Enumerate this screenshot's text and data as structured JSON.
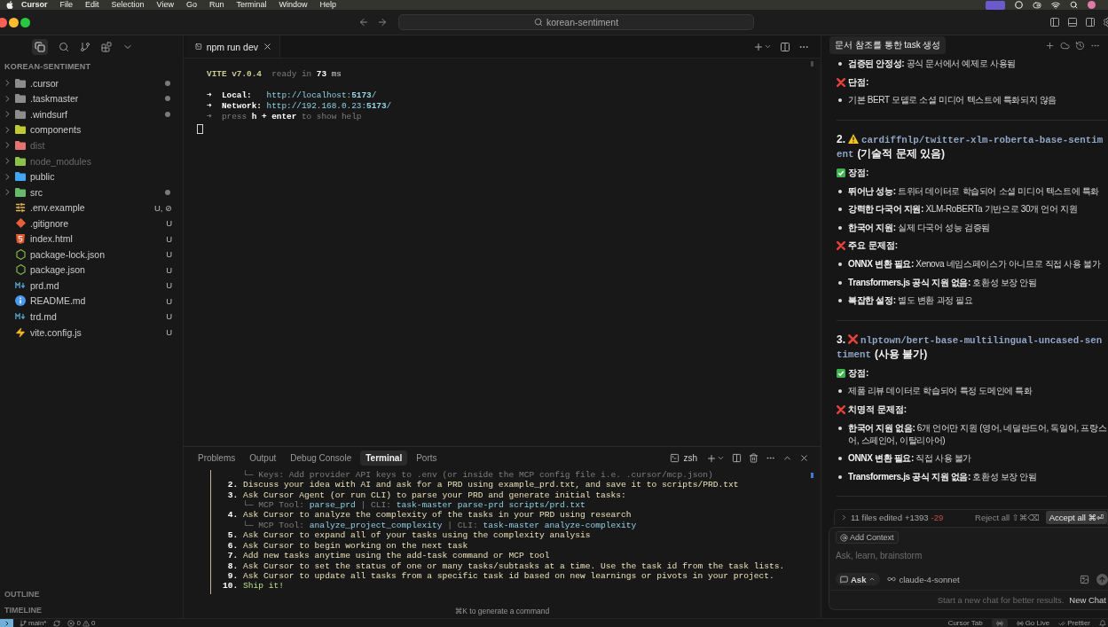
{
  "menu_bar": {
    "app": "Cursor",
    "items": [
      "File",
      "Edit",
      "Selection",
      "View",
      "Go",
      "Run",
      "Terminal",
      "Window",
      "Help"
    ]
  },
  "title_bar": {
    "search": "korean-sentiment"
  },
  "explorer": {
    "title": "KOREAN-SENTIMENT",
    "items": [
      {
        "kind": "folder",
        "label": ".cursor",
        "expanded": false,
        "color": "#8c8c8c",
        "dimmed": false,
        "modified": true
      },
      {
        "kind": "folder",
        "label": ".taskmaster",
        "expanded": false,
        "color": "#8c8c8c",
        "dimmed": false,
        "modified": true
      },
      {
        "kind": "folder",
        "label": ".windsurf",
        "expanded": false,
        "color": "#8c8c8c",
        "dimmed": false,
        "modified": true
      },
      {
        "kind": "folder",
        "label": "components",
        "expanded": false,
        "color": "#c0ca33",
        "dimmed": false,
        "modified": false
      },
      {
        "kind": "folder",
        "label": "dist",
        "expanded": false,
        "color": "#e57373",
        "dimmed": true,
        "modified": false
      },
      {
        "kind": "folder",
        "label": "node_modules",
        "expanded": false,
        "color": "#8bc34a",
        "dimmed": true,
        "modified": false
      },
      {
        "kind": "folder",
        "label": "public",
        "expanded": false,
        "color": "#42a5f5",
        "dimmed": false,
        "modified": false
      },
      {
        "kind": "folder",
        "label": "src",
        "expanded": false,
        "color": "#66bb6a",
        "dimmed": false,
        "modified": true
      },
      {
        "kind": "env",
        "label": ".env.example",
        "badge": "U, ⊘",
        "dimmed": false,
        "modified": false
      },
      {
        "kind": "git",
        "label": ".gitignore",
        "badge": "U",
        "dimmed": false,
        "modified": false
      },
      {
        "kind": "html",
        "label": "index.html",
        "badge": "U",
        "dimmed": false,
        "modified": false
      },
      {
        "kind": "nodejs",
        "label": "package-lock.json",
        "badge": "U",
        "dimmed": false,
        "modified": false
      },
      {
        "kind": "nodejs",
        "label": "package.json",
        "badge": "U",
        "dimmed": false,
        "modified": false
      },
      {
        "kind": "markdown",
        "label": "prd.md",
        "badge": "U",
        "dimmed": false,
        "modified": false
      },
      {
        "kind": "info",
        "label": "README.md",
        "badge": "U",
        "dimmed": false,
        "modified": false
      },
      {
        "kind": "markdown",
        "label": "trd.md",
        "badge": "U",
        "dimmed": false,
        "modified": false
      },
      {
        "kind": "vite",
        "label": "vite.config.js",
        "badge": "U",
        "dimmed": false,
        "modified": false
      }
    ],
    "sections": [
      "OUTLINE",
      "TIMELINE"
    ]
  },
  "editor_tabs": [
    {
      "label": "npm run dev",
      "selected": true
    }
  ],
  "dev_terminal": {
    "groups": [
      [
        [
          {
            "kind": "accent",
            "text": "VITE v7.0.4"
          },
          {
            "kind": "dim",
            "text": "  ready in "
          },
          {
            "kind": "bold",
            "text": "73"
          },
          {
            "kind": "plain",
            "text": " ms"
          }
        ]
      ],
      [
        [
          {
            "kind": "bold",
            "text": "➜  Local:"
          },
          {
            "kind": "link",
            "text": "   http://localhost:"
          },
          {
            "kind": "link-bold",
            "text": "5173"
          },
          {
            "kind": "link",
            "text": "/"
          }
        ],
        [
          {
            "kind": "bold",
            "text": "➜  Network:"
          },
          {
            "kind": "link",
            "text": " http://192.168.0.23:"
          },
          {
            "kind": "link-bold",
            "text": "5173"
          },
          {
            "kind": "link",
            "text": "/"
          }
        ],
        [
          {
            "kind": "dim",
            "text": "➜  press "
          },
          {
            "kind": "bold",
            "text": "h + enter"
          },
          {
            "kind": "dim",
            "text": " to show help"
          }
        ]
      ]
    ],
    "cursor": true
  },
  "panel": {
    "tabs": [
      {
        "label": "Problems",
        "selected": false
      },
      {
        "label": "Output",
        "selected": false
      },
      {
        "label": "Debug Console",
        "selected": false
      },
      {
        "label": "Terminal",
        "selected": true
      },
      {
        "label": "Ports",
        "selected": false
      }
    ],
    "shell": "zsh",
    "lines": [
      {
        "kind": "sub",
        "segments": [
          {
            "kind": "dim",
            "text": "└─ Keys: Add provider API keys to .env (or inside the MCP config file i.e. .cursor/mcp.json)"
          }
        ]
      },
      {
        "kind": "step",
        "number": "2.",
        "segments": [
          {
            "kind": "text",
            "text": "Discuss your idea with AI and ask for a PRD using example_prd.txt, and save it to scripts/PRD.txt"
          }
        ]
      },
      {
        "kind": "step",
        "number": "3.",
        "segments": [
          {
            "kind": "text",
            "text": "Ask Cursor Agent (or run CLI) to parse your PRD and generate initial tasks:"
          }
        ]
      },
      {
        "kind": "sub",
        "segments": [
          {
            "kind": "dim",
            "text": "└─ MCP Tool: "
          },
          {
            "kind": "link",
            "text": "parse_prd"
          },
          {
            "kind": "dim",
            "text": " | CLI: "
          },
          {
            "kind": "link",
            "text": "task-master parse-prd scripts/prd.txt"
          }
        ]
      },
      {
        "kind": "step",
        "number": "4.",
        "segments": [
          {
            "kind": "text",
            "text": "Ask Cursor to analyze the complexity of the tasks in your PRD using research"
          }
        ]
      },
      {
        "kind": "sub",
        "segments": [
          {
            "kind": "dim",
            "text": "└─ MCP Tool: "
          },
          {
            "kind": "link",
            "text": "analyze_project_complexity"
          },
          {
            "kind": "dim",
            "text": " | CLI: "
          },
          {
            "kind": "link",
            "text": "task-master analyze-complexity"
          }
        ]
      },
      {
        "kind": "step",
        "number": "5.",
        "segments": [
          {
            "kind": "text",
            "text": "Ask Cursor to expand all of your tasks using the complexity analysis"
          }
        ]
      },
      {
        "kind": "step",
        "number": "6.",
        "segments": [
          {
            "kind": "text",
            "text": "Ask Cursor to begin working on the next task"
          }
        ]
      },
      {
        "kind": "step",
        "number": "7.",
        "segments": [
          {
            "kind": "text",
            "text": "Add new tasks anytime using the add-task command or MCP tool"
          }
        ]
      },
      {
        "kind": "step",
        "number": "8.",
        "segments": [
          {
            "kind": "text",
            "text": "Ask Cursor to set the status of one or many tasks/subtasks at a time. Use the task id from the task lists."
          }
        ]
      },
      {
        "kind": "step",
        "number": "9.",
        "segments": [
          {
            "kind": "text",
            "text": "Ask Cursor to update all tasks from a specific task id based on new learnings or pivots in your project."
          }
        ]
      },
      {
        "kind": "step",
        "number": "10.",
        "segments": [
          {
            "kind": "success",
            "text": "Ship it!"
          }
        ]
      }
    ],
    "hint": "⌘K to generate a command"
  },
  "chat": {
    "tab": "문서 참조를 통한 task 생성",
    "blocks": [
      {
        "kind": "bullet",
        "text": "**검증된 안정성:** 공식 문서에서 예제로 사용됨"
      },
      {
        "kind": "cons",
        "text": "단점:"
      },
      {
        "kind": "bullet",
        "text": "기본 BERT 모델로 소셜 미디어 텍스트에 특화되지 않음"
      },
      {
        "kind": "divider"
      },
      {
        "kind": "warning-model",
        "number": "2.",
        "model": "cardiffnlp/twitter-xlm-roberta-base-sentiment",
        "note": "(기술적 문제 있음)"
      },
      {
        "kind": "pros",
        "text": "장점:"
      },
      {
        "kind": "bullet",
        "text": "**뛰어난 성능:** 트위터 데이터로 학습되어 소셜 미디어 텍스트에 특화"
      },
      {
        "kind": "bullet",
        "text": "**강력한 다국어 지원:** XLM-RoBERTa 기반으로 30개 언어 지원"
      },
      {
        "kind": "bullet",
        "text": "**한국어 지원:** 실제 다국어 성능 검증됨"
      },
      {
        "kind": "cons",
        "text": "주요 문제점:"
      },
      {
        "kind": "bullet",
        "text": "**ONNX 변환 필요:** Xenova 네임스페이스가 아니므로 직접 사용 불가"
      },
      {
        "kind": "bullet",
        "text": "**Transformers.js 공식 지원 없음:** 호환성 보장 안됨"
      },
      {
        "kind": "bullet",
        "text": "**복잡한 설정:** 별도 변환 과정 필요"
      },
      {
        "kind": "divider"
      },
      {
        "kind": "rejected-model",
        "number": "3.",
        "model": "nlptown/bert-base-multilingual-uncased-sentiment",
        "note": "(사용 불가)"
      },
      {
        "kind": "pros",
        "text": "장점:"
      },
      {
        "kind": "bullet",
        "text": "제품 리뷰 데이터로 학습되어 특정 도메인에 특화"
      },
      {
        "kind": "cons",
        "text": "치명적 문제점:"
      },
      {
        "kind": "bullet",
        "text": "**한국어 지원 없음:** 6개 언어만 지원 (영어, 네덜란드어, 독일어, 프랑스어, 스페인어, 이탈리아어)"
      },
      {
        "kind": "bullet",
        "text": "**ONNX 변환 필요:** 직접 사용 불가"
      },
      {
        "kind": "bullet",
        "text": "**Transformers.js 공식 지원 없음:** 호환성 보장 안됨"
      },
      {
        "kind": "divider"
      }
    ],
    "changes": {
      "summary": "11 files edited",
      "added": "+1393",
      "removed": "-29",
      "reject": "Reject all ⇧⌘⌫",
      "accept": "Accept all ⌘⏎"
    },
    "composer": {
      "context": "Add Context",
      "placeholder": "Ask, learn, brainstorm",
      "mode": "Ask",
      "model": "claude-4-sonnet"
    },
    "footer": {
      "note": "Start a new chat for better results.",
      "link": "New Chat"
    }
  },
  "status_bar": {
    "branch": "main*",
    "errors": "0",
    "warnings": "0",
    "cursor_tab": "Cursor Tab",
    "go_live": "Go Live",
    "prettier": "Prettier"
  }
}
